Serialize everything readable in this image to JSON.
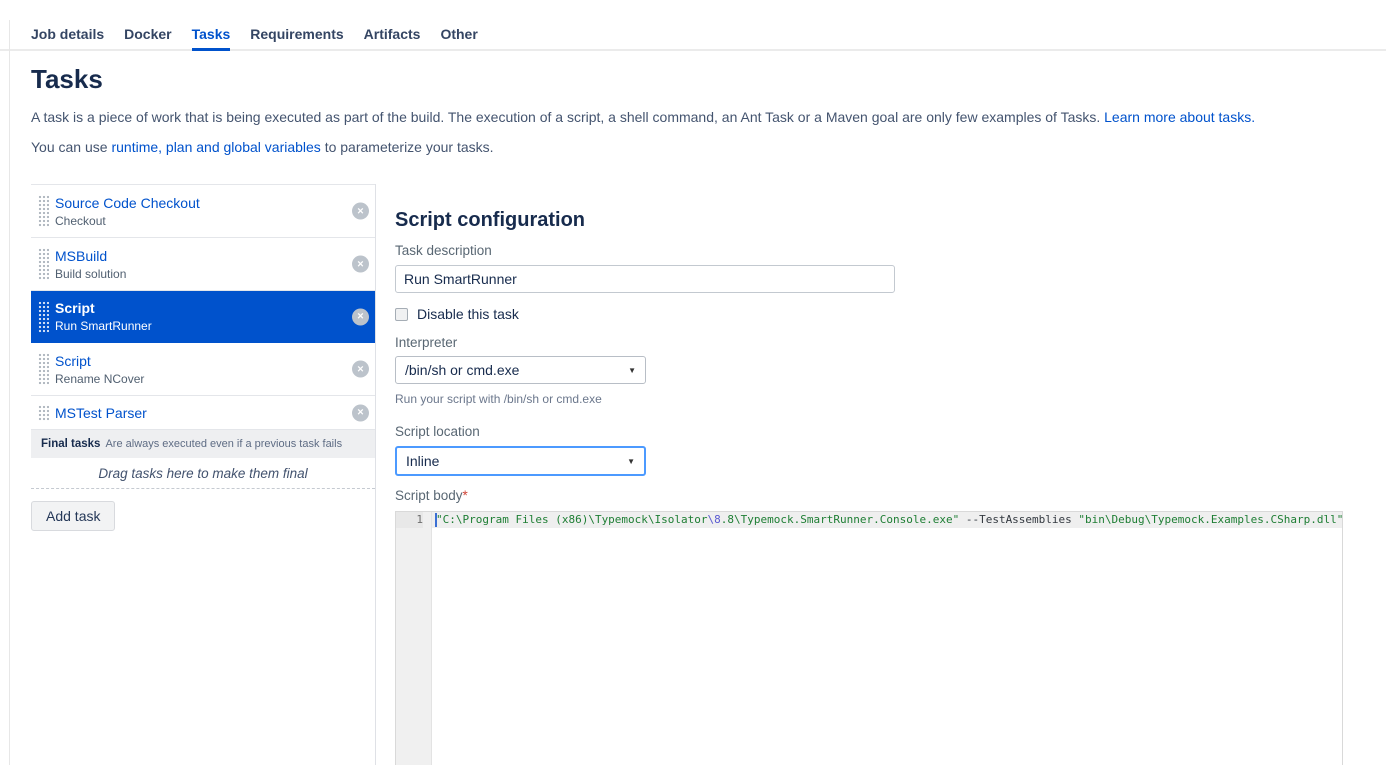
{
  "tabs": {
    "items": [
      {
        "label": "Job details",
        "active": false
      },
      {
        "label": "Docker",
        "active": false
      },
      {
        "label": "Tasks",
        "active": true
      },
      {
        "label": "Requirements",
        "active": false
      },
      {
        "label": "Artifacts",
        "active": false
      },
      {
        "label": "Other",
        "active": false
      }
    ]
  },
  "page": {
    "title": "Tasks",
    "intro_text": "A task is a piece of work that is being executed as part of the build. The execution of a script, a shell command, an Ant Task or a Maven goal are only few examples of Tasks. ",
    "intro_link": "Learn more about tasks.",
    "vars_prefix": "You can use ",
    "vars_link": "runtime, plan and global variables",
    "vars_suffix": " to parameterize your tasks."
  },
  "task_list": {
    "tasks": [
      {
        "title": "Source Code Checkout",
        "subtitle": "Checkout",
        "selected": false
      },
      {
        "title": "MSBuild",
        "subtitle": "Build solution",
        "selected": false
      },
      {
        "title": "Script",
        "subtitle": "Run SmartRunner",
        "selected": true
      },
      {
        "title": "Script",
        "subtitle": "Rename NCover",
        "selected": false
      },
      {
        "title": "MSTest Parser",
        "subtitle": "",
        "selected": false
      }
    ],
    "remove_icon": "×",
    "final_tasks_label": "Final tasks",
    "final_tasks_desc": "Are always executed even if a previous task fails",
    "drag_hint": "Drag tasks here to make them final",
    "add_task_label": "Add task"
  },
  "config": {
    "heading": "Script configuration",
    "task_description": {
      "label": "Task description",
      "value": "Run SmartRunner"
    },
    "disable": {
      "label": "Disable this task",
      "checked": false
    },
    "interpreter": {
      "label": "Interpreter",
      "value": "/bin/sh or cmd.exe",
      "help": "Run your script with /bin/sh or cmd.exe",
      "arrow_icon": "▼"
    },
    "script_location": {
      "label": "Script location",
      "value": "Inline",
      "arrow_icon": "▼",
      "focused": true
    },
    "script_body": {
      "label": "Script body",
      "required_mark": "*",
      "line_number": "1",
      "tokens": [
        {
          "type": "string",
          "text": "\"C:\\Program Files (x86)\\Typemock\\Isolator"
        },
        {
          "type": "escape",
          "text": "\\8"
        },
        {
          "type": "string",
          "text": ".8\\Typemock.SmartRunner.Console.exe\""
        },
        {
          "type": "plain",
          "text": " "
        },
        {
          "type": "option",
          "text": "--TestAssemblies"
        },
        {
          "type": "plain",
          "text": " "
        },
        {
          "type": "string",
          "text": "\"bin\\Debug\\Typemock.Examples.CSharp.dll\""
        }
      ]
    }
  },
  "colors": {
    "accent": "#0052CC",
    "selected_row_bg": "#0052CC",
    "link": "#0052CC",
    "tab_inactive": "#344563",
    "heading_text": "#172B4D",
    "focus_border": "#4C9AFF",
    "code_string": "#1e7e34",
    "code_escape": "#5a5ad2",
    "code_option": "#333940",
    "required_mark": "#d04437"
  }
}
